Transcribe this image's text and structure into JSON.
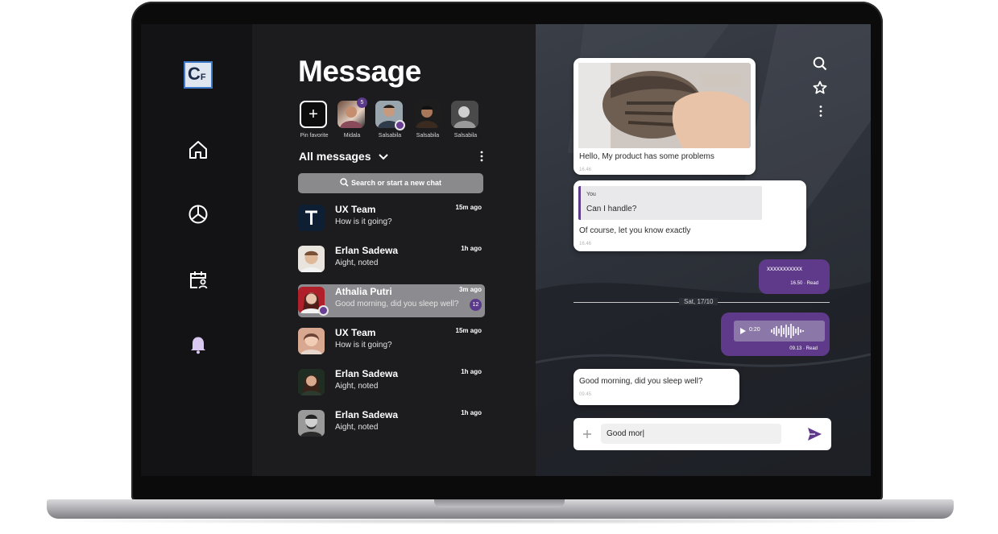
{
  "app": {
    "logo_text": "C",
    "logo_sub": "F",
    "title": "Message"
  },
  "sidebar": {
    "items": [
      {
        "name": "home-icon"
      },
      {
        "name": "chart-icon"
      },
      {
        "name": "calendar-user-icon"
      },
      {
        "name": "bell-icon"
      }
    ]
  },
  "pinned": {
    "add_label": "Pin favorite",
    "contacts": [
      {
        "label": "Midala",
        "badge": "5"
      },
      {
        "label": "Salsabila"
      },
      {
        "label": "Salsabila"
      },
      {
        "label": "Salsabila"
      }
    ]
  },
  "list": {
    "filter_label": "All messages",
    "search_placeholder": "Search or start a new chat",
    "items": [
      {
        "name": "UX Team",
        "preview": "How is it going?",
        "time": "15m ago"
      },
      {
        "name": "Erlan Sadewa",
        "preview": "Aight, noted",
        "time": "1h ago"
      },
      {
        "name": "Athalia Putri",
        "preview": "Good morning, did you sleep well?",
        "time": "3m ago",
        "unread": "12"
      },
      {
        "name": "UX Team",
        "preview": "How is it going?",
        "time": "15m ago"
      },
      {
        "name": "Erlan Sadewa",
        "preview": "Aight, noted",
        "time": "1h ago"
      },
      {
        "name": "Erlan Sadewa",
        "preview": "Aight, noted",
        "time": "1h ago"
      }
    ]
  },
  "conversation": {
    "messages": {
      "m1": {
        "text": "Hello,  My product has some problems",
        "time": "16.46"
      },
      "m2": {
        "quote_author": "You",
        "quote_text": "Can I handle?",
        "text": "Of course, let you know exactly",
        "time": "16.46"
      },
      "m3": {
        "text": "xxxxxxxxxxx",
        "meta": "16.50 · Read"
      },
      "separator": "Sat, 17/10",
      "m4": {
        "duration": "0:20",
        "meta": "09.13 · Read"
      },
      "m5": {
        "text": "Good morning, did you sleep well?",
        "time": "09.45"
      }
    },
    "composer": {
      "value": "Good mor|"
    }
  },
  "colors": {
    "accent": "#5f3a8a",
    "panel": "#1c1c1f",
    "sidebar": "#131315"
  }
}
